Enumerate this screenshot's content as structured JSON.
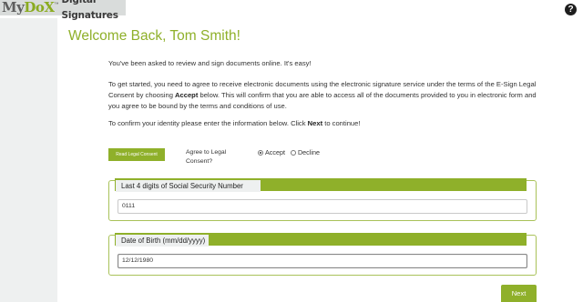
{
  "logo": {
    "brand_my": "My",
    "brand_dox": "DoX",
    "trademark": "™",
    "tagline": "Digital Signatures"
  },
  "help": {
    "icon": "question-circle-icon",
    "glyph": "?"
  },
  "welcome": "Welcome Back, Tom Smith!",
  "intro": {
    "p1": "You've been asked to review and sign documents online. It's easy!",
    "p2_before": "To get started, you need to agree to receive electronic documents using the electronic signature service under the terms of the E-Sign Legal Consent by choosing ",
    "p2_bold": "Accept",
    "p2_after": " below. This will confirm that you are able to access all of the documents provided to you in electronic form and you agree to be bound by the terms and conditions of use.",
    "p3_before": "To confirm your identity please enter the information below. Click ",
    "p3_bold": "Next",
    "p3_after": " to continue!"
  },
  "consent": {
    "read_button": "Read Legal Consent",
    "agree_label": "Agree to Legal Consent?",
    "options": [
      {
        "label": "Accept",
        "selected": true
      },
      {
        "label": "Decline",
        "selected": false
      }
    ]
  },
  "ssn": {
    "legend": "Last 4 digits of Social Security Number",
    "value": "0111"
  },
  "dob": {
    "legend": "Date of Birth (mm/dd/yyyy)",
    "value": "12/12/1980"
  },
  "next_button": "Next",
  "colors": {
    "accent": "#8fb02a",
    "sidebar": "#eef0f0",
    "logo_bg": "#d9dcdb"
  }
}
